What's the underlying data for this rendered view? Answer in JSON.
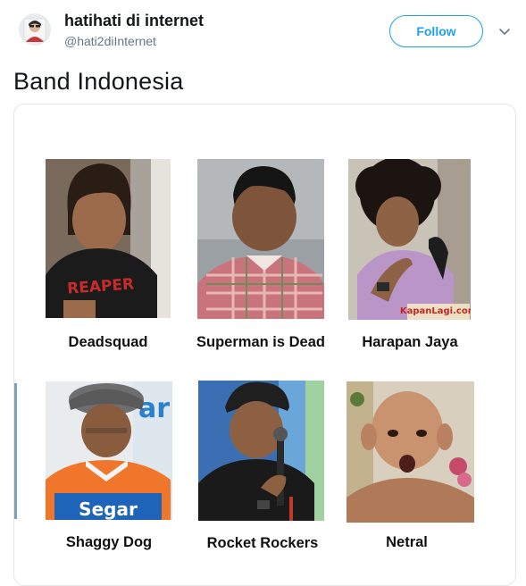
{
  "tweet": {
    "author": {
      "display_name": "hatihati di internet",
      "handle": "@hati2diInternet"
    },
    "follow_label": "Follow",
    "text": "Band Indonesia"
  },
  "media": {
    "items": [
      {
        "caption": "Deadsquad",
        "shirt_text": "REAPER"
      },
      {
        "caption": "Superman is Dead"
      },
      {
        "caption": "Harapan Jaya",
        "watermark": "KapanLagi.com"
      },
      {
        "caption": "Shaggy Dog",
        "background_text": "ar",
        "shirt_text": "Segar"
      },
      {
        "caption": "Rocket Rockers"
      },
      {
        "caption": "Netral"
      }
    ]
  },
  "colors": {
    "accent": "#1da1f2",
    "handle": "#657786",
    "border": "#e1e8ed"
  }
}
